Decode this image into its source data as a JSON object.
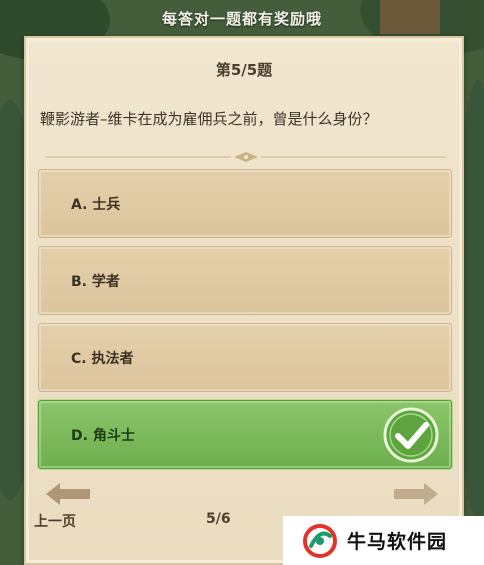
{
  "banner": {
    "text": "每答对一题都有奖励哦"
  },
  "quiz": {
    "counter": "第5/5题",
    "question": "鞭影游者–维卡在成为雇佣兵之前，曾是什么身份？",
    "options": [
      {
        "label": "A. 士兵",
        "state": "normal"
      },
      {
        "label": "B. 学者",
        "state": "normal"
      },
      {
        "label": "C. 执法者",
        "state": "normal"
      },
      {
        "label": "D. 角斗士",
        "state": "correct"
      }
    ]
  },
  "footer": {
    "prev_label": "上一页",
    "page": "5/6"
  },
  "watermark": {
    "text": "牛马软件园"
  },
  "colors": {
    "panel": "#eadcbf",
    "option": "#dcc59d",
    "correct": "#6daf4f",
    "text": "#3e3226"
  }
}
